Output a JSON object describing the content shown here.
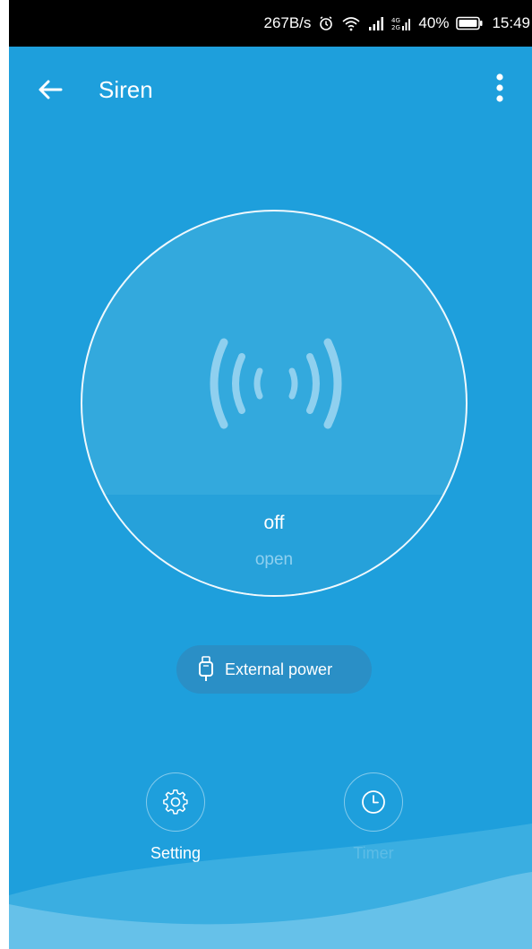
{
  "status_bar": {
    "net_speed": "267B/s",
    "battery_pct": "40%",
    "time": "15:49",
    "icons": [
      "alarm-icon",
      "wifi-icon",
      "signal-icon",
      "network-4g-icon",
      "battery-icon"
    ]
  },
  "app_bar": {
    "title": "Siren",
    "back_icon": "back-arrow-icon",
    "menu_icon": "more-vert-icon"
  },
  "device": {
    "icon": "siren-waves-icon",
    "state": "off",
    "action_label": "open"
  },
  "power": {
    "icon": "plug-icon",
    "label": "External power"
  },
  "controls": [
    {
      "label": "Setting",
      "icon": "gear-icon"
    },
    {
      "label": "Timer",
      "icon": "clock-icon"
    }
  ],
  "colors": {
    "background": "#1e9fdc",
    "circle_fill": "#33a9dd",
    "wave_light": "#6cc3ea"
  }
}
